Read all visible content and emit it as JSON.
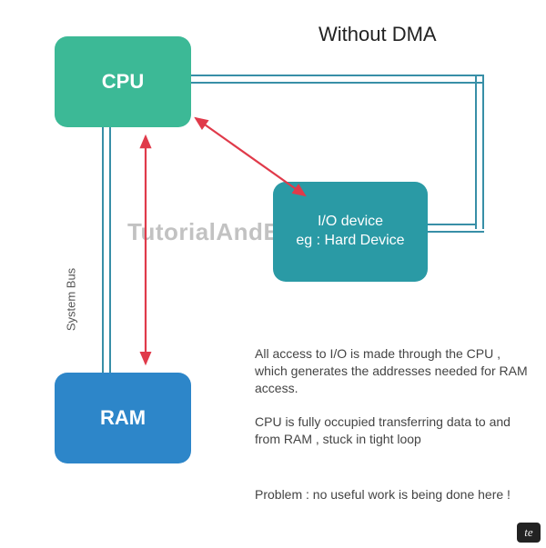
{
  "title": "Without DMA",
  "watermark": "TutorialAndExample",
  "cpu": {
    "label": "CPU"
  },
  "ram": {
    "label": "RAM"
  },
  "io": {
    "line1": "I/O device",
    "line2": "eg : Hard Device"
  },
  "bus_label": "System Bus",
  "desc": {
    "p1": "All access to I/O is made through the CPU , which generates the addresses needed for RAM access.",
    "p2": "CPU is fully occupied transferring data to and from RAM , stuck in tight loop",
    "p3": "Problem : no useful work is being done here !"
  },
  "badge": "te",
  "chart_data": {
    "type": "diagram",
    "title": "Without DMA",
    "nodes": [
      {
        "id": "cpu",
        "label": "CPU",
        "color": "#3cb996"
      },
      {
        "id": "ram",
        "label": "RAM",
        "color": "#2d86c9"
      },
      {
        "id": "io",
        "label": "I/O device eg : Hard Device",
        "color": "#2a9aa5"
      }
    ],
    "edges": [
      {
        "from": "cpu",
        "to": "ram",
        "label": "System Bus",
        "style": "bus",
        "bidirectional": true
      },
      {
        "from": "cpu",
        "to": "io",
        "label": "System Bus",
        "style": "bus",
        "bidirectional": true
      },
      {
        "from": "cpu",
        "to": "ram",
        "style": "data-transfer-arrow",
        "bidirectional": true,
        "color": "#e03a4a"
      },
      {
        "from": "cpu",
        "to": "io",
        "style": "data-transfer-arrow",
        "bidirectional": true,
        "color": "#e03a4a"
      }
    ],
    "annotations": [
      "All access to I/O is made through the CPU , which generates the addresses needed for RAM access.",
      "CPU is fully occupied transferring data to and from RAM , stuck in tight loop",
      "Problem : no useful work is being done here !"
    ]
  }
}
